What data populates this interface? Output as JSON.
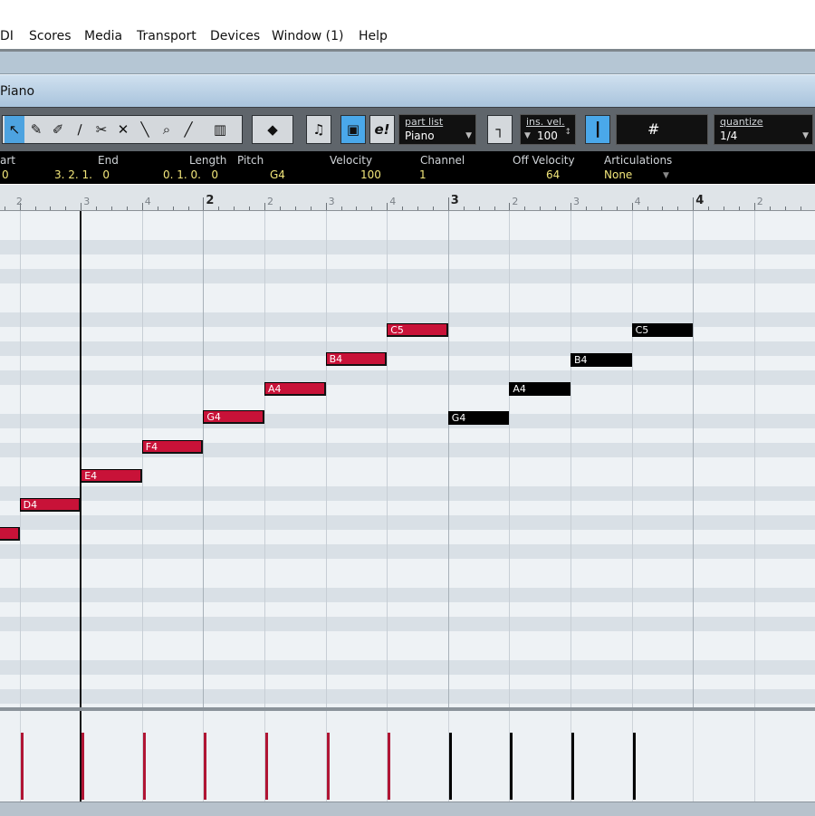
{
  "menu": [
    "DI",
    "Scores",
    "Media",
    "Transport",
    "Devices",
    "Window (1)",
    "Help"
  ],
  "window_title": "Piano",
  "toolbar": {
    "part_list_label": "part list",
    "part_list_value": "Piano",
    "ins_vel_label": "ins. vel.",
    "ins_vel_value": "100",
    "quantize_label": "quantize",
    "quantize_value": "1/4",
    "hash_symbol": "#",
    "tools": [
      "object-select-icon",
      "draw-icon",
      "erase-icon",
      "trim-icon",
      "split-icon",
      "mute-icon",
      "glue-icon",
      "zoom-icon",
      "line-icon",
      "timewarp-icon"
    ]
  },
  "infoline": {
    "start_label": "art",
    "start_value": "0",
    "end_label": "End",
    "end_value": "3. 2. 1.   0",
    "length_label": "Length",
    "length_value": "0. 1. 0.   0",
    "pitch_label": "Pitch",
    "pitch_value": "G4",
    "velocity_label": "Velocity",
    "velocity_value": "100",
    "channel_label": "Channel",
    "channel_value": "1",
    "off_velocity_label": "Off Velocity",
    "off_velocity_value": "64",
    "articulations_label": "Articulations",
    "articulations_value": "None"
  },
  "ruler": [
    "2",
    "3",
    "4",
    "2",
    "2",
    "3",
    "4",
    "3",
    "2",
    "3",
    "4",
    "4",
    "2"
  ],
  "notes": [
    {
      "label": "",
      "selected": true
    },
    {
      "label": "D4",
      "selected": true
    },
    {
      "label": "E4",
      "selected": true
    },
    {
      "label": "F4",
      "selected": true
    },
    {
      "label": "G4",
      "selected": true
    },
    {
      "label": "A4",
      "selected": true
    },
    {
      "label": "B4",
      "selected": true
    },
    {
      "label": "C5",
      "selected": true
    },
    {
      "label": "G4",
      "selected": false
    },
    {
      "label": "A4",
      "selected": false
    },
    {
      "label": "B4",
      "selected": false
    },
    {
      "label": "C5",
      "selected": false
    }
  ],
  "colors": {
    "selected_note": "#c81238",
    "unselected_note": "#000000",
    "tool_active": "#4da3e0"
  }
}
